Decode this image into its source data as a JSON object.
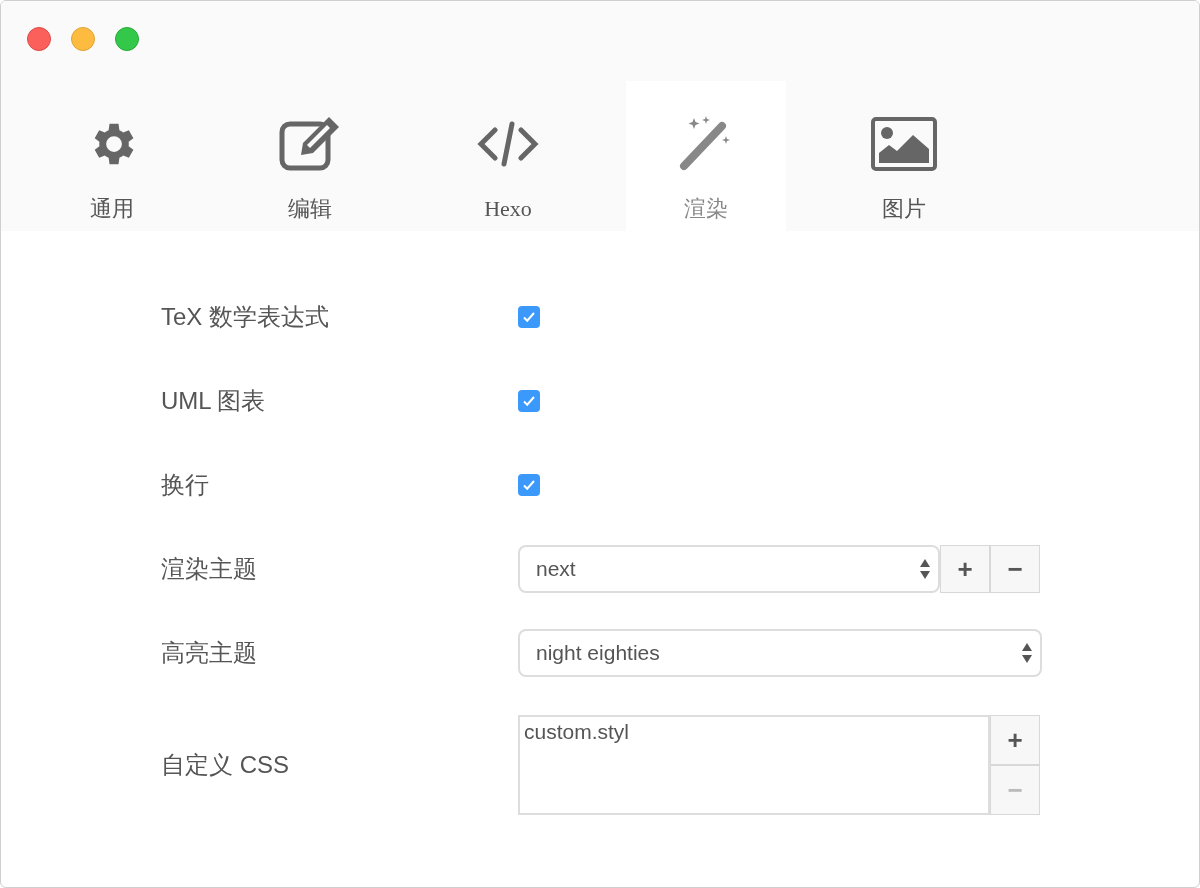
{
  "tabs": [
    {
      "kind": "gear",
      "label": "通用",
      "selected": false
    },
    {
      "kind": "edit",
      "label": "编辑",
      "selected": false
    },
    {
      "kind": "code",
      "label": "Hexo",
      "selected": false
    },
    {
      "kind": "wand",
      "label": "渲染",
      "selected": true
    },
    {
      "kind": "image",
      "label": "图片",
      "selected": false
    }
  ],
  "rows": [
    {
      "kind": "checkbox",
      "label": "TeX 数学表达式",
      "checked": true
    },
    {
      "kind": "checkbox",
      "label": "UML 图表",
      "checked": true
    },
    {
      "kind": "checkbox",
      "label": "换行",
      "checked": true
    },
    {
      "kind": "select",
      "label": "渲染主题",
      "value": "next",
      "buttons": [
        {
          "label": "+",
          "disabled": false
        },
        {
          "label": "−",
          "disabled": false
        }
      ]
    },
    {
      "kind": "select",
      "label": "高亮主题",
      "value": "night eighties"
    },
    {
      "kind": "list",
      "label": "自定义 CSS",
      "items": [
        "custom.styl"
      ],
      "buttons": [
        {
          "label": "+",
          "disabled": false
        },
        {
          "label": "−",
          "disabled": true
        }
      ]
    }
  ]
}
